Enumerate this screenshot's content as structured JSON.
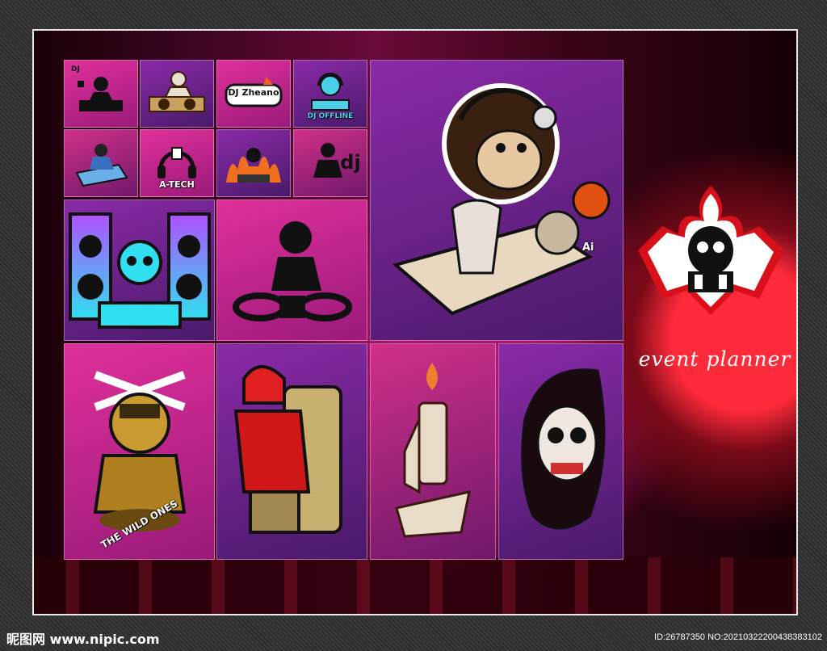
{
  "tiles": {
    "dj_small_label": "DJ",
    "zheano_label": "DJ Zheano",
    "dj_offline_label": "DJ OFFLINE",
    "atech_label": "A-TECH",
    "dj_lower_label": "dj",
    "ai_ball_label": "Ai",
    "wild_ones_label": "THE WILD ONES"
  },
  "logo": {
    "tagline": "event planner"
  },
  "watermark": {
    "site": "昵图网 www.nipic.com",
    "id": "ID:26787350 NO:20210322200438383102"
  },
  "colors": {
    "accent_pink": "#e0309a",
    "accent_purple": "#7a1a8a",
    "logo_red": "#d8101a"
  }
}
